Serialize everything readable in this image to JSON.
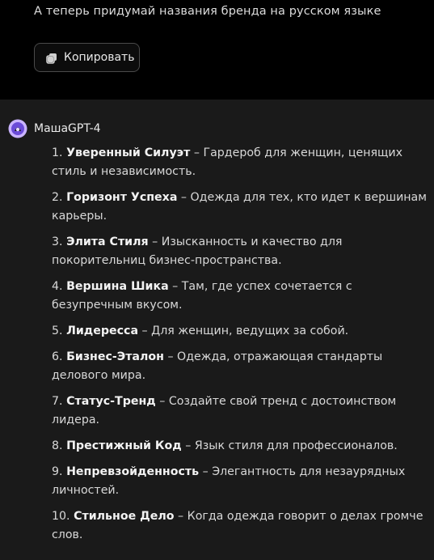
{
  "user": {
    "message": "А теперь придумай названия бренда на русском языке",
    "copy_label": "Копировать"
  },
  "assistant": {
    "name": "МашаGPT-4",
    "items": [
      {
        "num": "1.",
        "name": "Уверенный Силуэт",
        "desc": " – Гардероб для женщин, ценящих стиль и независимость."
      },
      {
        "num": "2.",
        "name": "Горизонт Успеха",
        "desc": " – Одежда для тех, кто идет к вершинам карьеры."
      },
      {
        "num": "3.",
        "name": "Элита Стиля",
        "desc": " – Изысканность и качество для покорительниц бизнес-пространства."
      },
      {
        "num": "4.",
        "name": "Вершина Шика",
        "desc": " – Там, где успех сочетается с безупречным вкусом."
      },
      {
        "num": "5.",
        "name": "Лидересса",
        "desc": " – Для женщин, ведущих за собой."
      },
      {
        "num": "6.",
        "name": "Бизнес-Эталон",
        "desc": " – Одежда, отражающая стандарты делового мира."
      },
      {
        "num": "7.",
        "name": "Статус-Тренд",
        "desc": " – Создайте свой тренд с достоинством лидера."
      },
      {
        "num": "8.",
        "name": "Престижный Код",
        "desc": " – Язык стиля для профессионалов."
      },
      {
        "num": "9.",
        "name": "Непревзойденность",
        "desc": " – Элегантность для незаурядных личностей."
      },
      {
        "num": "10.",
        "name": "Стильное Дело",
        "desc": " – Когда одежда говорит о делах громче слов."
      }
    ]
  },
  "colors": {
    "page_bg": "#000000",
    "assistant_bg": "#1a1a1a",
    "avatar_ring": "#c9b3ff",
    "avatar_fill": "#6b4bd8"
  },
  "icons": {
    "copy": "copy-icon",
    "avatar": "assistant-avatar-icon"
  }
}
